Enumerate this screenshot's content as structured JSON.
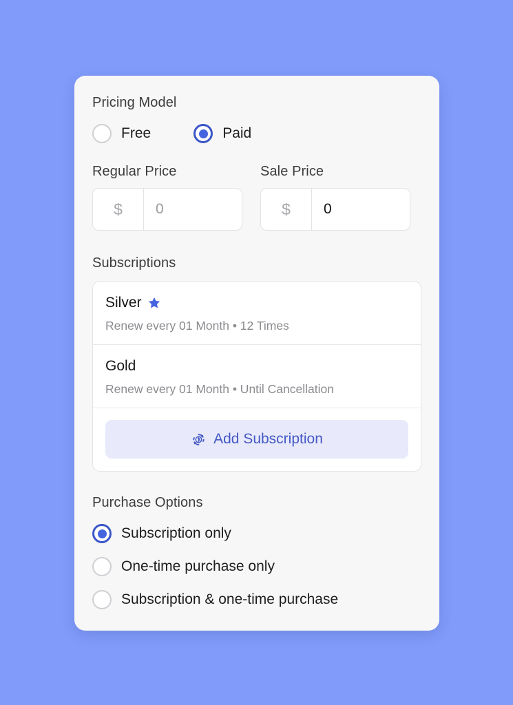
{
  "theme": {
    "page_background": "#819bfa",
    "card_background": "#f7f7f7",
    "accent_blue": "#4565e0",
    "accent_ring": "#3a56c8",
    "button_background": "#e8eafb",
    "button_text": "#4458c4",
    "star_color": "#4565e0",
    "muted_text": "#8b8b90",
    "heading_text": "#3c3c3e"
  },
  "pricing_model": {
    "label": "Pricing Model",
    "options": [
      {
        "id": "free",
        "label": "Free",
        "selected": false
      },
      {
        "id": "paid",
        "label": "Paid",
        "selected": true
      }
    ]
  },
  "prices": {
    "regular": {
      "label": "Regular Price",
      "currency_symbol": "$",
      "value": "",
      "placeholder": "0",
      "displayed": "0",
      "is_placeholder": true
    },
    "sale": {
      "label": "Sale Price",
      "currency_symbol": "$",
      "value": "0",
      "placeholder": "0",
      "displayed": "0",
      "is_placeholder": false
    }
  },
  "subscriptions": {
    "label": "Subscriptions",
    "items": [
      {
        "name": "Silver",
        "details": "Renew every 01 Month • 12 Times",
        "starred": true,
        "star_icon": "star-icon"
      },
      {
        "name": "Gold",
        "details": "Renew every 01 Month • Until Cancellation",
        "starred": false,
        "star_icon": ""
      }
    ],
    "add_button": {
      "label": "Add Subscription",
      "icon": "recurring-payment-icon"
    }
  },
  "purchase_options": {
    "label": "Purchase Options",
    "options": [
      {
        "id": "subscription-only",
        "label": "Subscription only",
        "selected": true
      },
      {
        "id": "one-time-only",
        "label": "One-time purchase only",
        "selected": false
      },
      {
        "id": "subscription-and-one-time",
        "label": "Subscription & one-time purchase",
        "selected": false
      }
    ]
  }
}
